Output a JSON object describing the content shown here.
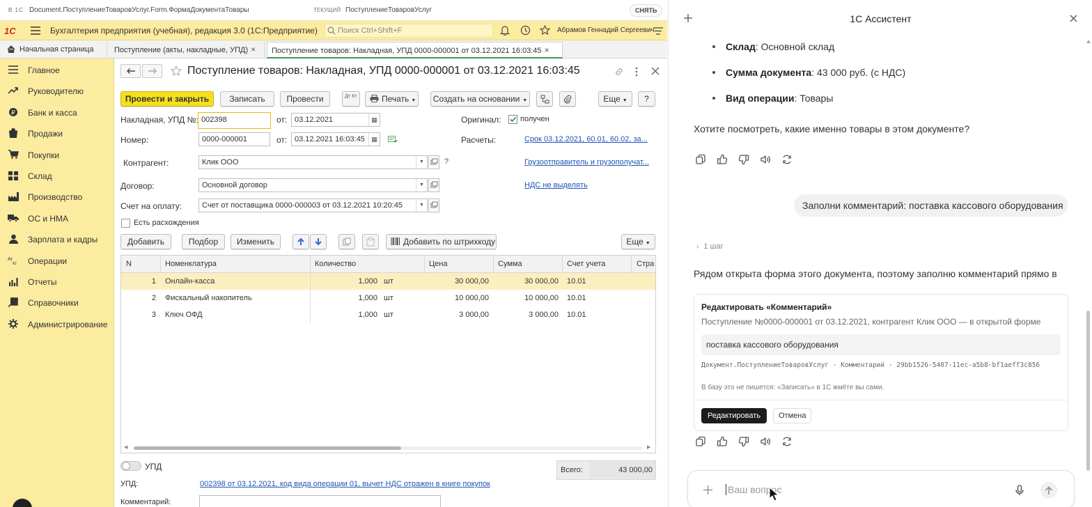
{
  "titlebar": {
    "sys": "В 1С",
    "path": "Document.ПоступлениеТоваровУслуг.Form.ФормаДокументаТовары",
    "current_label": "ТЕКУЩИЙ",
    "current_value": "ПоступлениеТоваровУслуг",
    "snyat": "СНЯТЬ"
  },
  "topbar": {
    "logo": "1C",
    "app_title": "Бухгалтерия предприятия (учебная), редакция 3.0  (1С:Предприятие)",
    "search_placeholder": "Поиск Ctrl+Shift+F",
    "user": "Абрамов Геннадий Сергеевич"
  },
  "tabs": [
    {
      "label": "Начальная страница"
    },
    {
      "label": "Поступление (акты, накладные, УПД)"
    },
    {
      "label": "Поступление товаров: Накладная, УПД 0000-000001 от 03.12.2021 16:03:45"
    }
  ],
  "sidebar": {
    "items": [
      {
        "label": "Главное",
        "icon": "menu-lines-icon"
      },
      {
        "label": "Руководителю",
        "icon": "trend-icon"
      },
      {
        "label": "Банк и касса",
        "icon": "coin-icon"
      },
      {
        "label": "Продажи",
        "icon": "bag-icon"
      },
      {
        "label": "Покупки",
        "icon": "cart-icon"
      },
      {
        "label": "Склад",
        "icon": "warehouse-icon"
      },
      {
        "label": "Производство",
        "icon": "factory-icon"
      },
      {
        "label": "ОС и НМА",
        "icon": "truck-icon"
      },
      {
        "label": "Зарплата и кадры",
        "icon": "person-icon"
      },
      {
        "label": "Операции",
        "icon": "dt-kt-icon"
      },
      {
        "label": "Отчеты",
        "icon": "bar-chart-icon"
      },
      {
        "label": "Справочники",
        "icon": "book-icon"
      },
      {
        "label": "Администрирование",
        "icon": "gear-icon"
      }
    ]
  },
  "form": {
    "title": "Поступление товаров: Накладная, УПД 0000-000001 от 03.12.2021 16:03:45",
    "toolbar": {
      "post_close": "Провести и закрыть",
      "save": "Записать",
      "post": "Провести",
      "dtkt": "Дт Кт",
      "print": "Печать",
      "create_based": "Создать на основании",
      "more": "Еще",
      "help": "?"
    },
    "fields": {
      "invoice_label": "Накладная, УПД №:",
      "invoice_no": "002398",
      "from_label": "от:",
      "invoice_date": "03.12.2021",
      "number_label": "Номер:",
      "number": "0000-000001",
      "number_date": "03.12.2021 16:03:45",
      "original_label": "Оригинал:",
      "original_checked": "получен",
      "settlements_label": "Расчеты:",
      "settlements_link": "Срок 03.12.2021, 60.01, 60.02, за...",
      "counterparty_label": "Контрагент:",
      "counterparty": "Клик ООО",
      "consignor_link": "Грузоотправитель и грузополучат...",
      "contract_label": "Договор:",
      "contract": "Основной договор",
      "vat_link": "НДС не выделять",
      "invoice_pay_label": "Счет на оплату:",
      "invoice_pay": "Счет от поставщика 0000-000003 от 03.12.2021 10:20:45",
      "discrepancy": "Есть расхождения"
    },
    "table_toolbar": {
      "add": "Добавить",
      "pick": "Подбор",
      "change": "Изменить",
      "barcode": "Добавить по штрихкоду",
      "more": "Еще"
    },
    "table": {
      "columns": [
        "N",
        "Номенклатура",
        "Количество",
        "Цена",
        "Сумма",
        "Счет учета",
        "Стра"
      ],
      "rows": [
        {
          "n": "1",
          "name": "Онлайн-касса",
          "qty": "1,000",
          "unit": "шт",
          "price": "30 000,00",
          "sum": "30 000,00",
          "account": "10.01"
        },
        {
          "n": "2",
          "name": "Фискальный накопитель",
          "qty": "1,000",
          "unit": "шт",
          "price": "10 000,00",
          "sum": "10 000,00",
          "account": "10.01"
        },
        {
          "n": "3",
          "name": "Ключ ОФД",
          "qty": "1,000",
          "unit": "шт",
          "price": "3 000,00",
          "sum": "3 000,00",
          "account": "10.01"
        }
      ]
    },
    "footer": {
      "upd_toggle": "УПД",
      "total_label": "Всего:",
      "total": "43 000,00",
      "upd_label": "УПД:",
      "upd_link": "002398 от 03.12.2021, код вида операции 01, вычет НДС отражен в книге покупок",
      "comment_label": "Комментарий:"
    }
  },
  "assistant": {
    "title": "1С Ассистент",
    "bullets": [
      {
        "key": "Склад",
        "value": ": Основной склад"
      },
      {
        "key": "Сумма документа",
        "value": ": 43 000 руб. (с НДС)"
      },
      {
        "key": "Вид операции",
        "value": ": Товары"
      }
    ],
    "question": "Хотите посмотреть, какие именно товары в этом документе?",
    "user_message": "Заполни комментарий: поставка кассового оборудования",
    "steps": "1 шаг",
    "reply": "Рядом открыта форма этого документа, поэтому заполню комментарий прямо в",
    "card": {
      "title": "Редактировать «Комментарий»",
      "subtitle": "Поступление №0000-000001 от 03.12.2021, контрагент Клик ООО — в открытой форме",
      "value": "поставка кассового оборудования",
      "path": "Документ.ПоступлениеТоваровУслуг · Комментарий · 29bb1526-5407-11ec-a5b8-bf1aeff3c856",
      "note": "В базу это не пишется: «Записать» в 1С жмёте вы сами.",
      "edit": "Редактировать",
      "cancel": "Отмена"
    },
    "input_placeholder": "Ваш вопрос"
  }
}
